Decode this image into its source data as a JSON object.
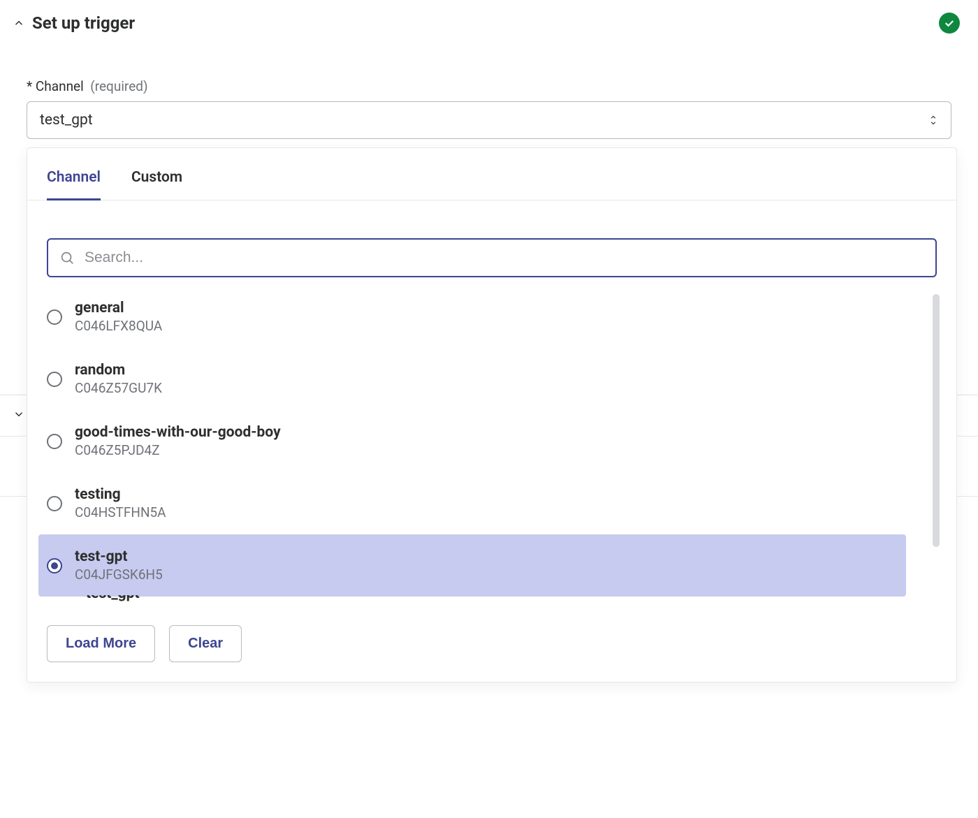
{
  "section": {
    "title": "Set up trigger"
  },
  "field": {
    "label_prefix": "*",
    "label_text": "Channel",
    "required_text": "(required)",
    "selected_value": "test_gpt"
  },
  "dropdown": {
    "tabs": [
      {
        "label": "Channel",
        "active": true
      },
      {
        "label": "Custom",
        "active": false
      }
    ],
    "search_placeholder": "Search...",
    "options": [
      {
        "name": "general",
        "id": "C046LFX8QUA",
        "selected": false
      },
      {
        "name": "random",
        "id": "C046Z57GU7K",
        "selected": false
      },
      {
        "name": "good-times-with-our-good-boy",
        "id": "C046Z5PJD4Z",
        "selected": false
      },
      {
        "name": "testing",
        "id": "C04HSTFHN5A",
        "selected": false
      },
      {
        "name": "test-gpt",
        "id": "C04JFGSK6H5",
        "selected": true
      }
    ],
    "partial_next": "test_gpt",
    "load_more": "Load More",
    "clear": "Clear"
  }
}
